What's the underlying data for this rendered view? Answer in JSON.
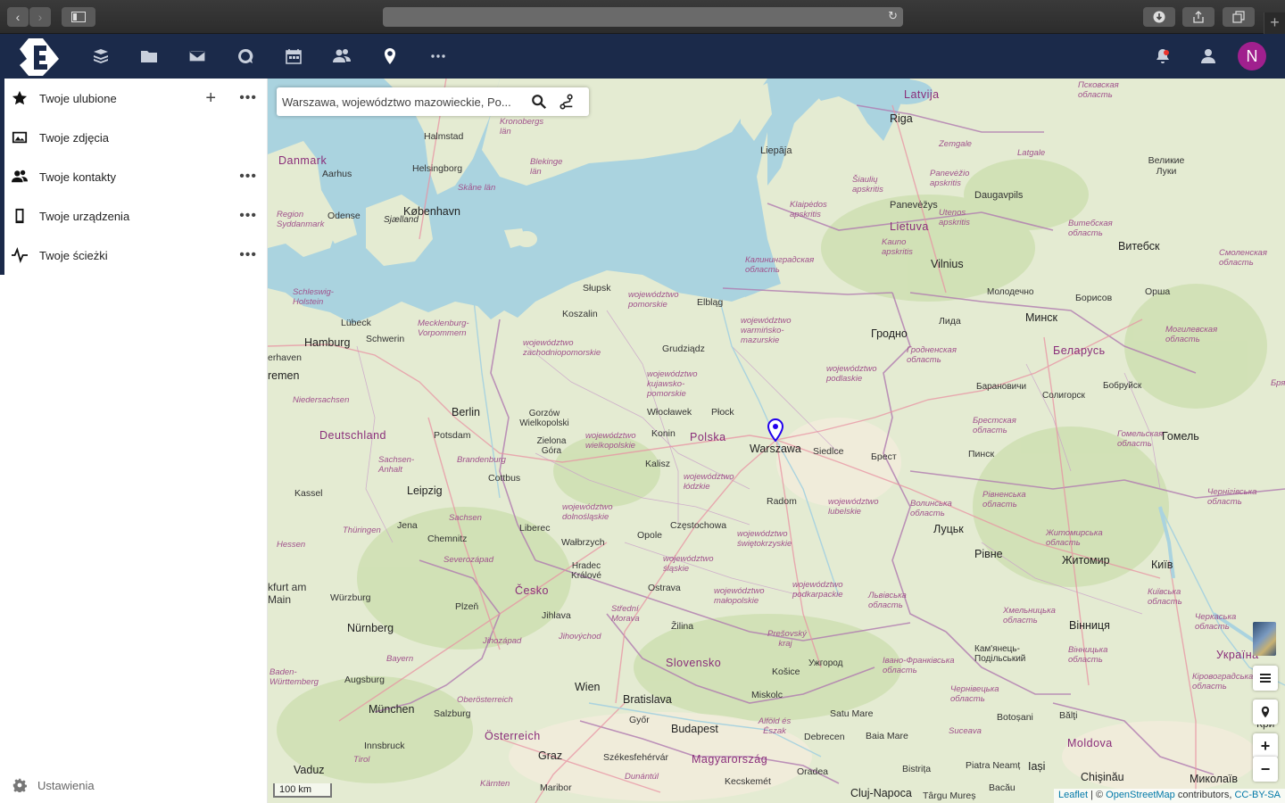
{
  "browser": {
    "back": "‹",
    "forward": "›",
    "reload": "↻",
    "new_tab": "+"
  },
  "header": {
    "avatar_initial": "N",
    "notification_color": "#e9322d"
  },
  "sidebar": {
    "items": [
      {
        "label": "Twoje ulubione",
        "icon": "star-icon"
      },
      {
        "label": "Twoje zdjęcia",
        "icon": "image-icon"
      },
      {
        "label": "Twoje kontakty",
        "icon": "contacts-icon"
      },
      {
        "label": "Twoje urządzenia",
        "icon": "phone-icon"
      },
      {
        "label": "Twoje ścieżki",
        "icon": "activity-icon"
      }
    ],
    "more": "•••",
    "add": "+",
    "settings_label": "Ustawienia"
  },
  "map": {
    "search_value": "Warszawa, województwo mazowieckie, Po...",
    "marker_label": "Warszawa",
    "scale": "100 km",
    "attribution": {
      "leaflet": "Leaflet",
      "sep": " | © ",
      "osm": "OpenStreetMap",
      "contributors": " contributors, ",
      "license": "CC-BY-SA"
    },
    "zoom_in": "+",
    "zoom_out": "−",
    "labels": {
      "latvija": "Latvija",
      "riga": "Riga",
      "liepaja": "Liepāja",
      "zemgale": "Zemgale",
      "latgale": "Latgale",
      "pskov": "Псковская область",
      "velikie_luki": "Великие Луки",
      "daugavpils": "Daugavpils",
      "panevezys": "Panevėžys",
      "siauliu": "Šiaulių apskritis",
      "panevezio": "Panevėžio apskritis",
      "utenos": "Utenos apskritis",
      "lietuva": "Lietuva",
      "kauno": "Kauno apskritis",
      "klaipedos": "Klaipėdos apskritis",
      "vilnius": "Vilnius",
      "vitebsk_obl": "Витебская область",
      "vitebsk": "Витебск",
      "smolensk": "Смоленская область",
      "kaliningrad": "Калининградская область",
      "molodechno": "Молодечно",
      "borisov": "Борисов",
      "orsha": "Орша",
      "minsk": "Минск",
      "lida": "Лида",
      "grodno": "Гродно",
      "mogilev": "Могилевская область",
      "belarus": "Беларусь",
      "grodno_obl": "Гродненская область",
      "baranovichi": "Барановичи",
      "soligorsk": "Солигорск",
      "bobruisk": "Бобруйск",
      "brest_obl": "Брестская область",
      "gomel_obl": "Гомельская область",
      "gomel": "Гомель",
      "pinsk": "Пинск",
      "brest": "Брест",
      "danmark": "Danmark",
      "halmstad": "Halmstad",
      "kronobergs": "Kronobergs län",
      "helsingborg": "Helsingborg",
      "blekinge": "Blekinge län",
      "aarhus": "Aarhus",
      "skane": "Skåne län",
      "kobenhavn": "København",
      "odense": "Odense",
      "sjaelland": "Sjælland",
      "region_syd": "Region Syddanmark",
      "slupsk": "Słupsk",
      "pomorskie": "województwo pomorskie",
      "elblag": "Elbląg",
      "koszalin": "Koszalin",
      "warminsko": "województwo warmińsko-mazurskie",
      "podlaskie": "województwo podlaskie",
      "zachodniopomorskie": "województwo zachodniopomorskie",
      "grudziadz": "Grudziądz",
      "kujawsko": "województwo kujawsko-pomorskie",
      "wloclawek": "Włocławek",
      "plock": "Płock",
      "polska": "Polska",
      "konin": "Konin",
      "siedlce": "Siedlce",
      "wielkopolskie": "województwo wielkopolskie",
      "gorzow": "Gorzów Wielkopolski",
      "zielona": "Zielona Góra",
      "kalisz": "Kalisz",
      "lodzkie": "województwo łódzkie",
      "radom": "Radom",
      "lubelskie": "województwo lubelskie",
      "dolnoslaskie": "województwo dolnośląskie",
      "czestochowa": "Częstochowa",
      "swietokrzyskie": "województwo świętokrzyskie",
      "opole": "Opole",
      "walbrzych": "Wałbrzych",
      "liberec": "Liberec",
      "slaskie": "województwo śląskie",
      "hradec": "Hradec Králové",
      "ostrava": "Ostrava",
      "malopolskie": "województwo małopolskie",
      "podkarpackie": "województwo podkarpackie",
      "schleswig": "Schleswig-Holstein",
      "lubeck": "Lübeck",
      "mecklenburg": "Mecklenburg-Vorpommern",
      "hamburg": "Hamburg",
      "schwerin": "Schwerin",
      "bremerhaven": "erhaven",
      "bremen": "remen",
      "niedersachsen": "Niedersachsen",
      "berlin": "Berlin",
      "deutschland": "Deutschland",
      "potsdam": "Potsdam",
      "brandenburg": "Brandenburg",
      "sachsen_anhalt": "Sachsen-Anhalt",
      "cottbus": "Cottbus",
      "leipzig": "Leipzig",
      "kassel": "Kassel",
      "sachsen": "Sachsen",
      "thuringen": "Thüringen",
      "jena": "Jena",
      "chemnitz": "Chemnitz",
      "hessen": "Hessen",
      "severozapad": "Severozápad",
      "frankfurt": "kfurt am Main",
      "wurzburg": "Würzburg",
      "cesko": "Česko",
      "plzen": "Plzeň",
      "nurnberg": "Nürnberg",
      "jihlava": "Jihlava",
      "stredni_morava": "Střední Morava",
      "zilina": "Žilina",
      "jihozapad": "Jihozápad",
      "jihovychod": "Jihovýchod",
      "bayern": "Bayern",
      "slovensko": "Slovensko",
      "presovsky": "Prešovský kraj",
      "uzhhorod": "Ужгород",
      "kosice": "Košice",
      "baden": "Baden-Württemberg",
      "augsburg": "Augsburg",
      "wien": "Wien",
      "bratislava": "Bratislava",
      "miskolc": "Miskolc",
      "munchen": "München",
      "salzburg": "Salzburg",
      "oberosterreich": "Oberösterreich",
      "gyor": "Győr",
      "budapest": "Budapest",
      "osterreich": "Österreich",
      "innsbruck": "Innsbruck",
      "tirol": "Tirol",
      "graz": "Graz",
      "szekesfehervar": "Székesfehérvár",
      "magyarorszag": "Magyarország",
      "vaduz": "Vaduz",
      "karnten": "Kärnten",
      "maribor": "Maribor",
      "kecskemet": "Kecskemét",
      "dunantul": "Dunántúl",
      "oradea": "Oradea",
      "cluj": "Cluj-Napoca",
      "targu": "Târgu Mureș",
      "satu_mare": "Satu Mare",
      "baia_mare": "Baia Mare",
      "debrecen": "Debrecen",
      "alfold": "Alföld és Észak",
      "bistrita": "Bistrița",
      "suceava": "Suceava",
      "botosani": "Botoșani",
      "balti": "Bălţi",
      "moldova": "Moldova",
      "piatra": "Piatra Neamț",
      "iasi": "Iași",
      "chisinau": "Chişinău",
      "bacau": "Bacău",
      "mykolaiv": "Миколаїв",
      "volyn": "Волинська область",
      "lutsk": "Луцьк",
      "rivne_obl": "Рівненська область",
      "rivne": "Рівне",
      "zhytomyr_obl": "Житомирська область",
      "zhytomyr": "Житомир",
      "kyiv": "Київ",
      "kyiv_obl": "Київська область",
      "chernihiv": "Чернігівська область",
      "lviv": "Львівська область",
      "ivano": "Івано-Франківська область",
      "khmelnytsk": "Хмельницька область",
      "kamianets": "Кам'янець-Подільський",
      "vinnytsia": "Вінниця",
      "vinnytsia_obl": "Вінницька область",
      "chernivtsi": "Чернівецька область",
      "cherkasy": "Черкаська область",
      "ukraina": "Україна",
      "kirovohrad": "Кіровоградська область",
      "bryansk": "Бря",
      "kryvyi": "Кри"
    }
  }
}
